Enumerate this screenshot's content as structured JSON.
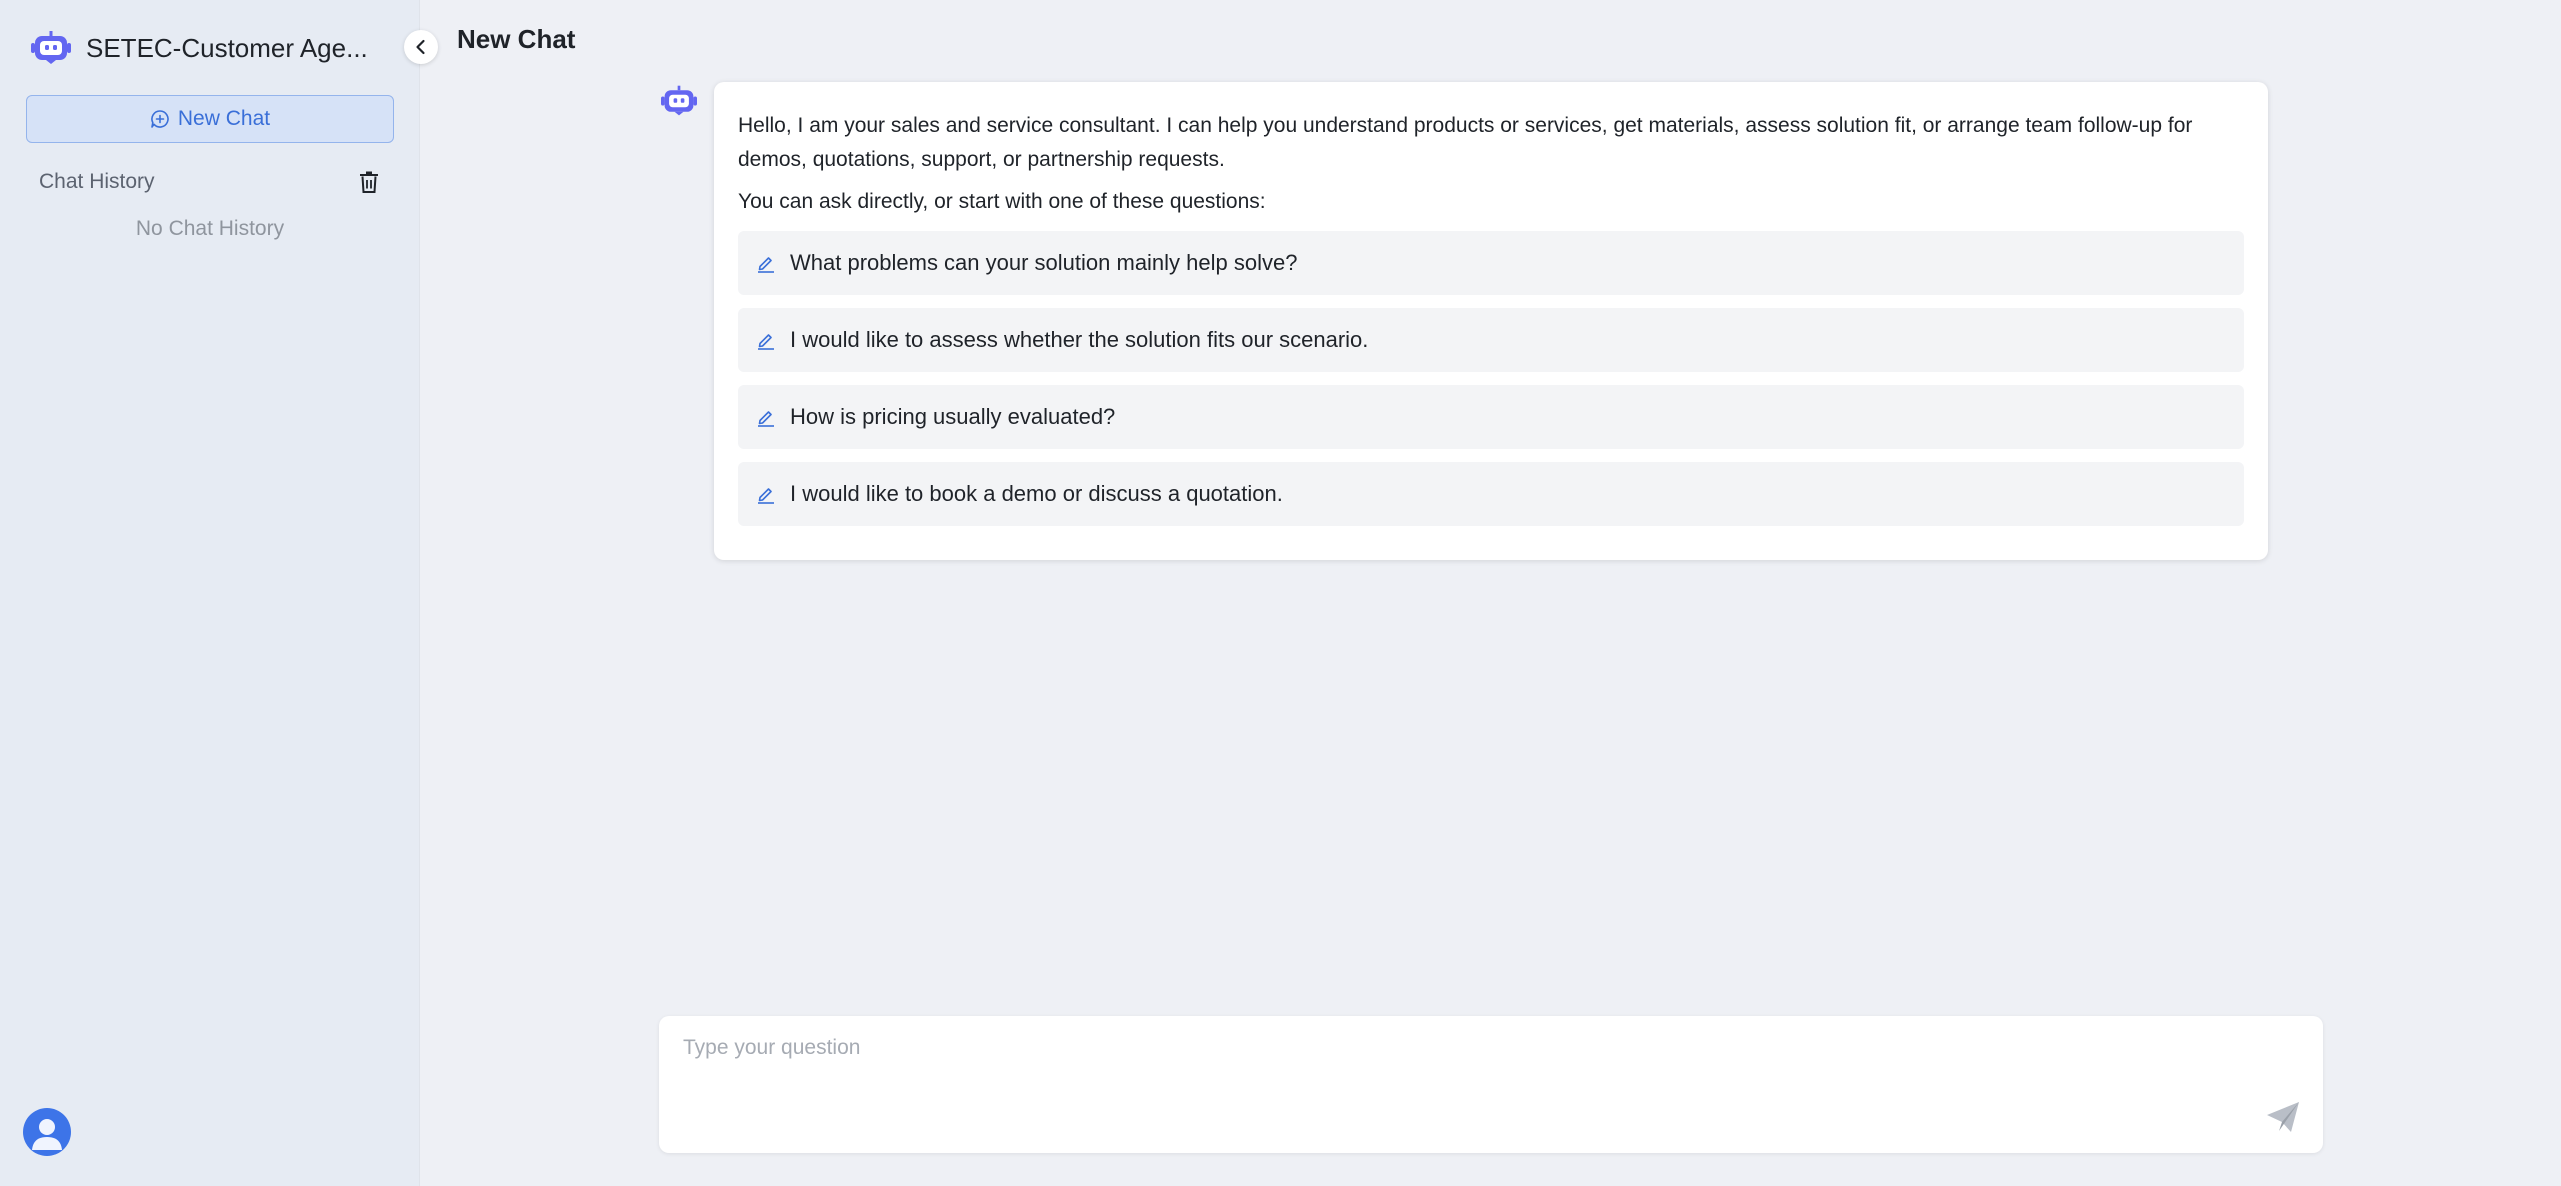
{
  "sidebar": {
    "app_title": "SETEC-Customer Age...",
    "new_chat_label": "New Chat",
    "history_title": "Chat History",
    "empty_history_text": "No Chat History"
  },
  "header": {
    "title": "New Chat"
  },
  "message": {
    "greeting": "Hello, I am your sales and service consultant. I can help you understand products or services, get materials, assess solution fit, or arrange team follow-up for demos, quotations, support, or partnership requests.",
    "prompt": "You can ask directly, or start with one of these questions:",
    "suggestions": [
      "What problems can your solution mainly help solve?",
      "I would like to assess whether the solution fits our scenario.",
      "How is pricing usually evaluated?",
      "I would like to book a demo or discuss a quotation."
    ]
  },
  "composer": {
    "placeholder": "Type your question"
  },
  "colors": {
    "accent": "#3a6fd8",
    "bot_icon": "#6366f1",
    "avatar": "#3d74e8"
  },
  "icons": {
    "logo": "robot-icon",
    "collapse": "chevron-left-icon",
    "new_chat": "chat-plus-icon",
    "delete_history": "trash-icon",
    "suggestion": "pencil-icon",
    "send": "send-icon",
    "user": "user-icon"
  }
}
